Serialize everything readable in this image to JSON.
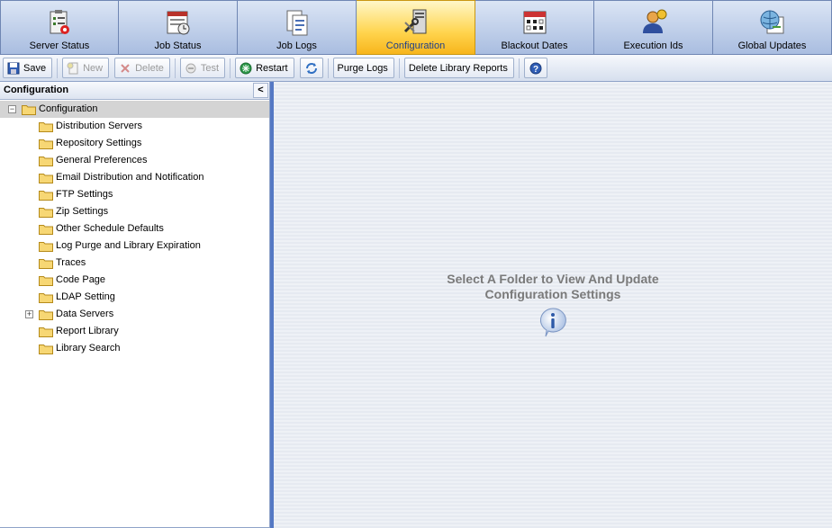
{
  "tabs": [
    {
      "label": "Server Status",
      "icon": "server-status-icon",
      "active": false
    },
    {
      "label": "Job Status",
      "icon": "job-status-icon",
      "active": false
    },
    {
      "label": "Job Logs",
      "icon": "job-logs-icon",
      "active": false
    },
    {
      "label": "Configuration",
      "icon": "configuration-icon",
      "active": true
    },
    {
      "label": "Blackout Dates",
      "icon": "calendar-icon",
      "active": false
    },
    {
      "label": "Execution Ids",
      "icon": "user-id-icon",
      "active": false
    },
    {
      "label": "Global Updates",
      "icon": "globe-update-icon",
      "active": false
    }
  ],
  "toolbar": {
    "save": "Save",
    "new": "New",
    "delete": "Delete",
    "test": "Test",
    "restart": "Restart",
    "refresh_icon": "refresh-icon",
    "purge_logs": "Purge Logs",
    "delete_library_reports": "Delete Library Reports",
    "help_icon": "help-icon"
  },
  "left_panel": {
    "title": "Configuration",
    "collapse_glyph": "<",
    "root": {
      "label": "Configuration",
      "expanded": true,
      "selected": true
    },
    "children": [
      {
        "label": "Distribution Servers",
        "expandable": false
      },
      {
        "label": "Repository Settings",
        "expandable": false
      },
      {
        "label": "General Preferences",
        "expandable": false
      },
      {
        "label": "Email Distribution and Notification",
        "expandable": false
      },
      {
        "label": "FTP Settings",
        "expandable": false
      },
      {
        "label": "Zip Settings",
        "expandable": false
      },
      {
        "label": "Other Schedule Defaults",
        "expandable": false
      },
      {
        "label": "Log Purge and Library Expiration",
        "expandable": false
      },
      {
        "label": "Traces",
        "expandable": false
      },
      {
        "label": "Code Page",
        "expandable": false
      },
      {
        "label": "LDAP Setting",
        "expandable": false
      },
      {
        "label": "Data Servers",
        "expandable": true
      },
      {
        "label": "Report Library",
        "expandable": false
      },
      {
        "label": "Library Search",
        "expandable": false
      }
    ]
  },
  "main": {
    "message_line1": "Select A Folder to View And Update",
    "message_line2": "Configuration Settings",
    "info_icon": "info-icon"
  },
  "colors": {
    "active_tab": "#ffd44d",
    "accent_border": "#5579c4",
    "selected_row": "#d4d4d4"
  }
}
